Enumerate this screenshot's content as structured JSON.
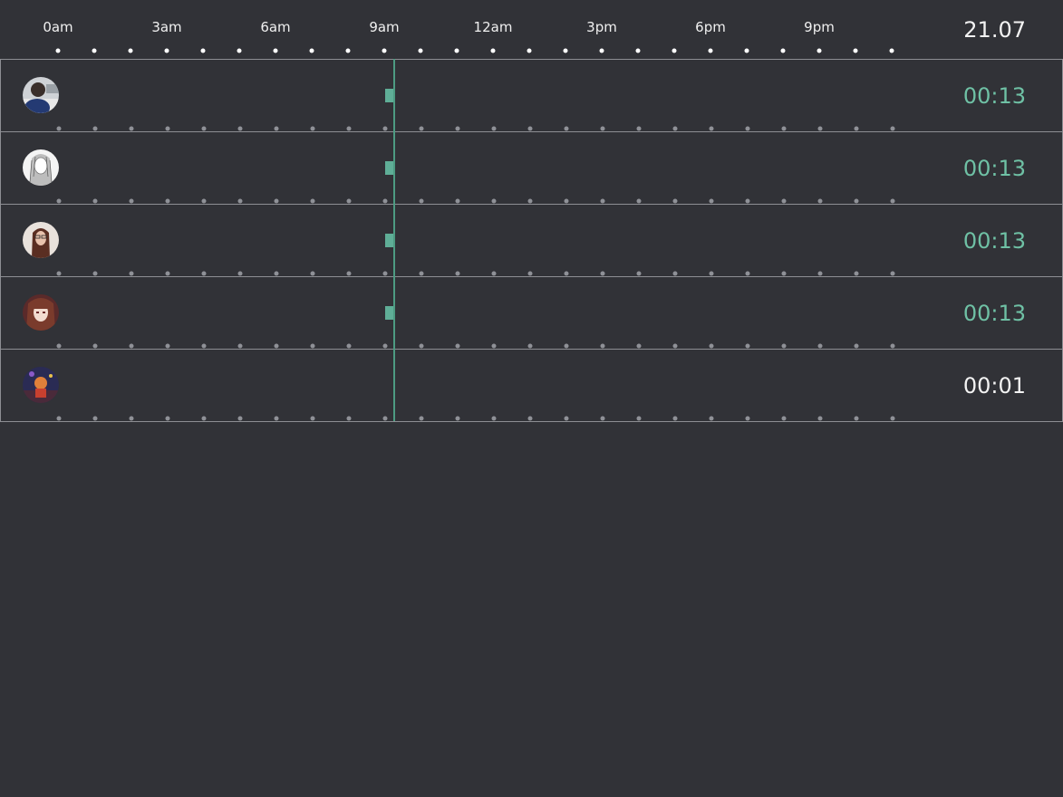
{
  "timeline": {
    "hour_labels": [
      "0am",
      "3am",
      "6am",
      "9am",
      "12am",
      "3pm",
      "6pm",
      "9pm"
    ],
    "date": "21.07"
  },
  "colors": {
    "background": "#313237",
    "accent": "#6fc1a5",
    "now_line": "#4d9b82",
    "text": "#f0f0f0"
  },
  "users": [
    {
      "avatar": "avatar-man-photo",
      "duration": "00:13",
      "active": true
    },
    {
      "avatar": "avatar-sketch-girl",
      "duration": "00:13",
      "active": true
    },
    {
      "avatar": "avatar-woman-glasses",
      "duration": "00:13",
      "active": true
    },
    {
      "avatar": "avatar-anime-girl",
      "duration": "00:13",
      "active": true
    },
    {
      "avatar": "avatar-game-character",
      "duration": "00:01",
      "active": false
    }
  ]
}
